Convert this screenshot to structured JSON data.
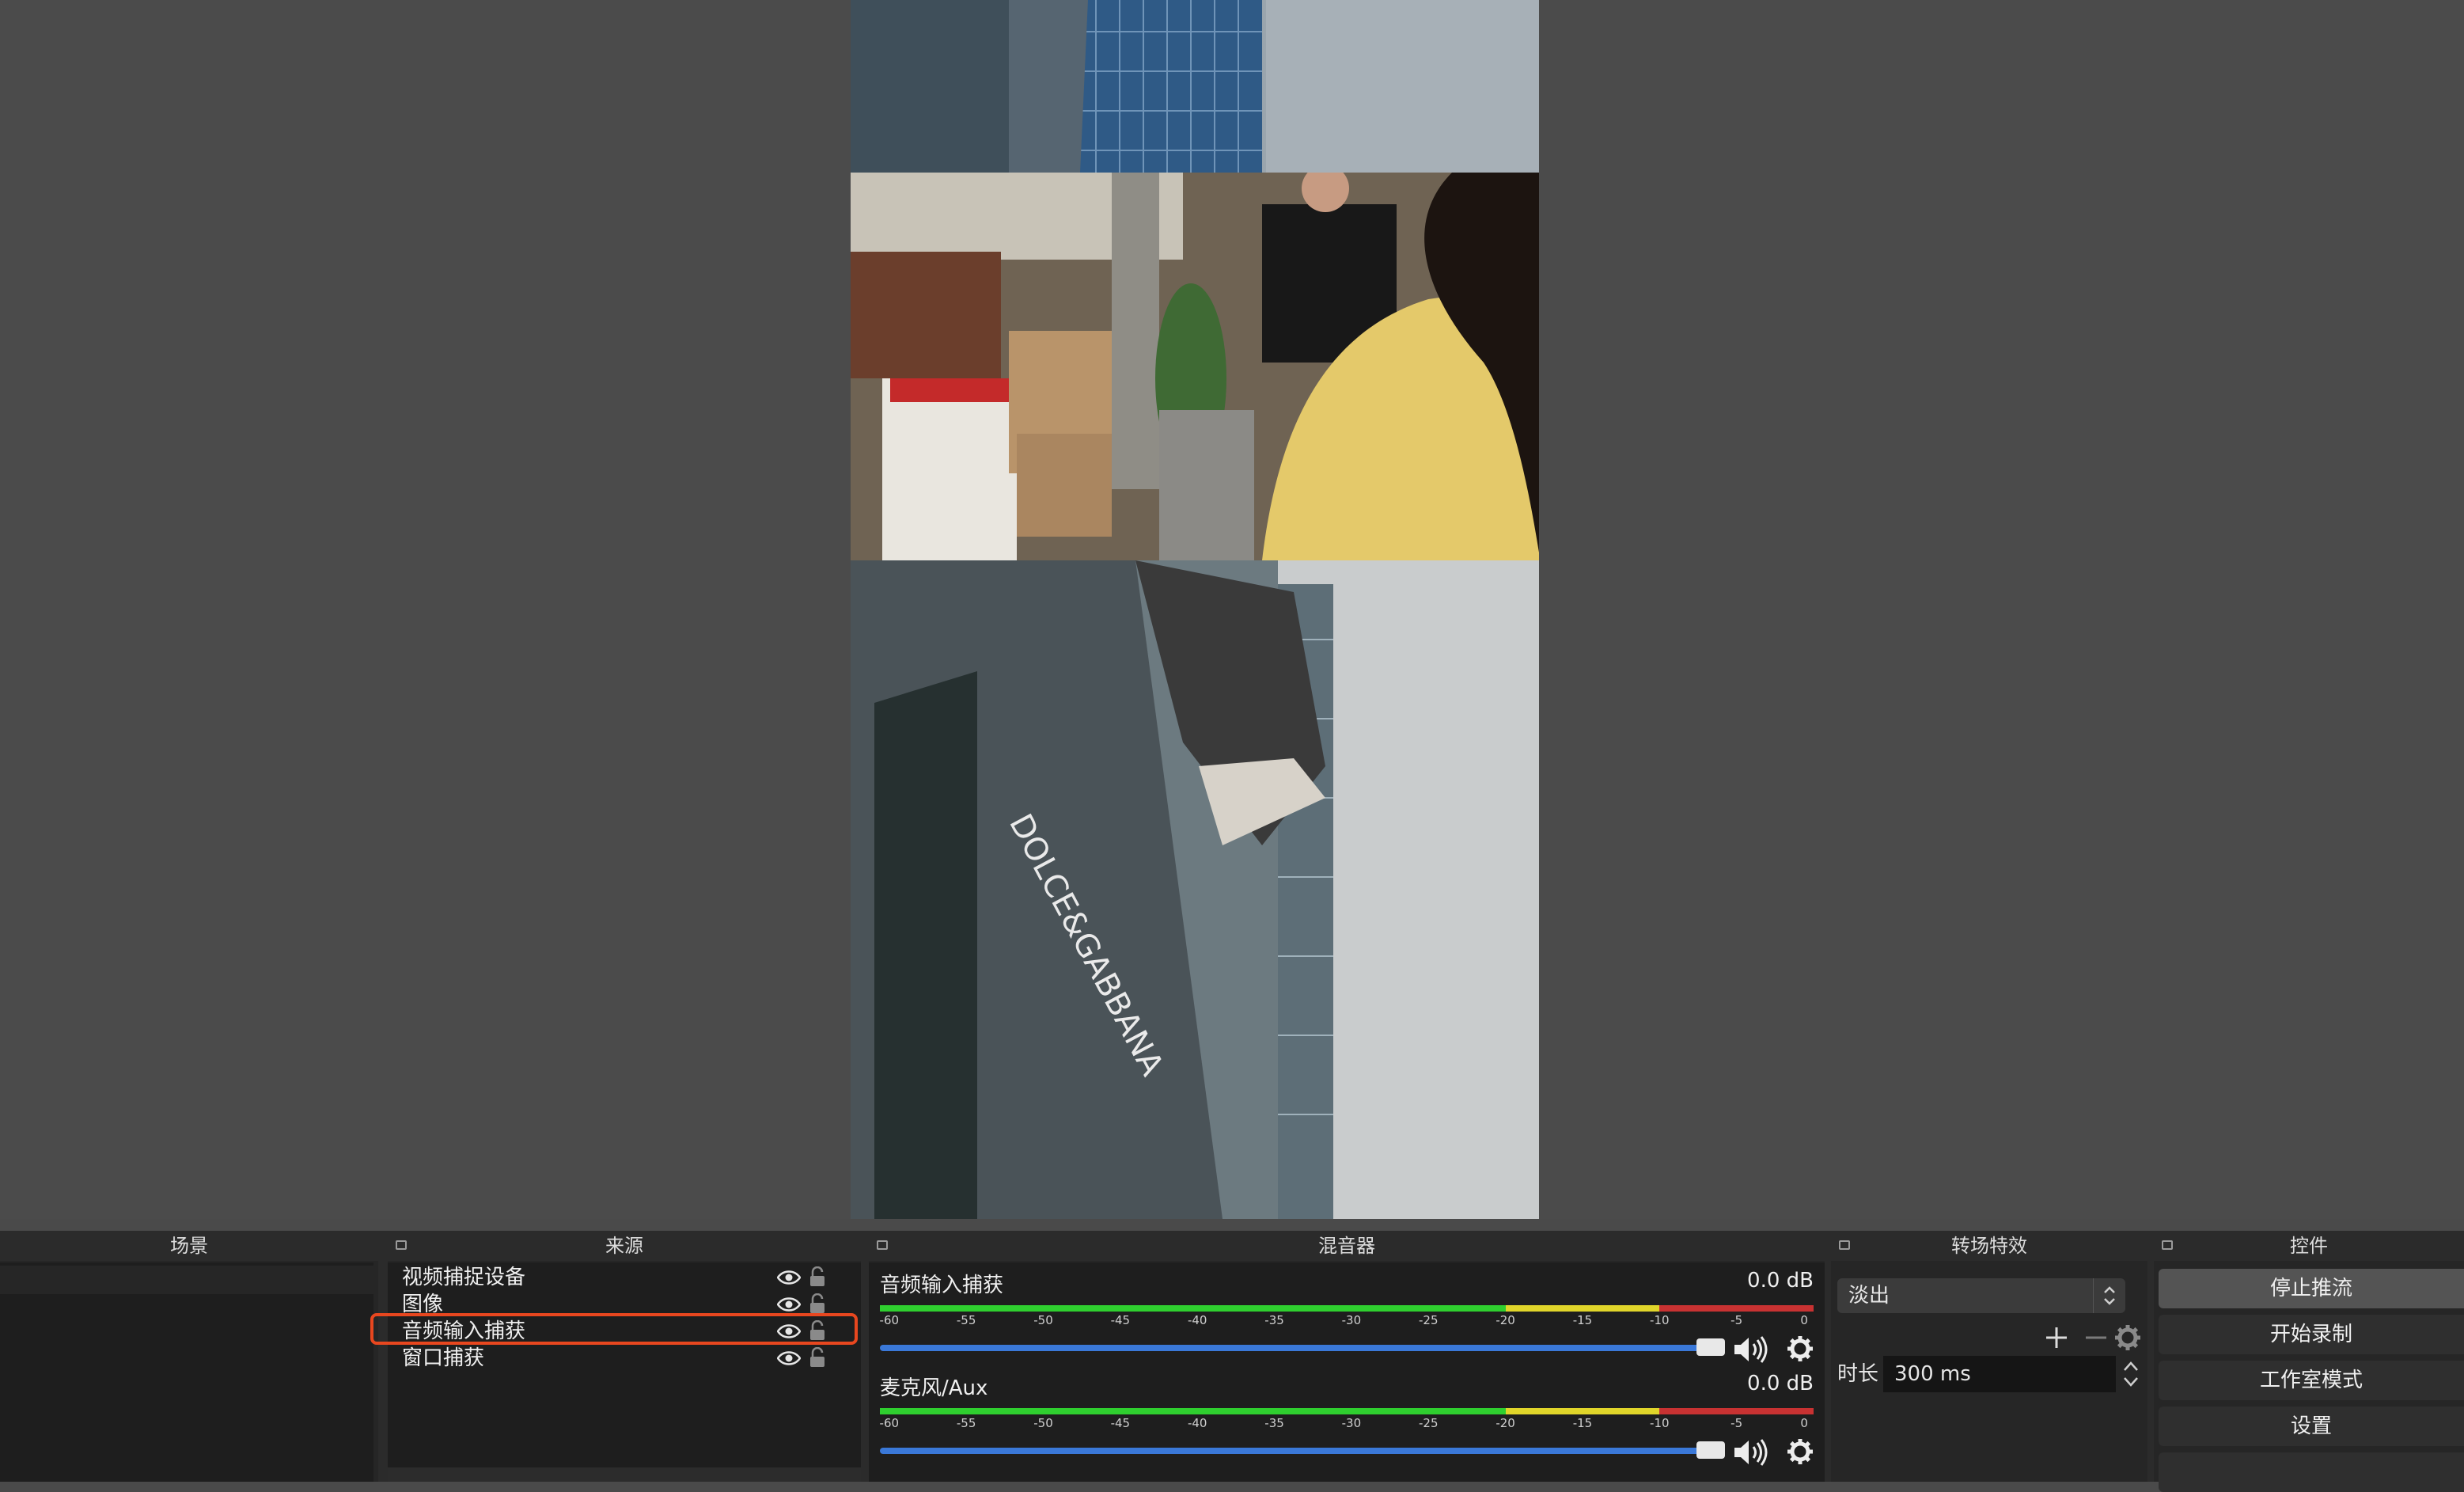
{
  "panels": {
    "scenes": {
      "title": "场景"
    },
    "sources": {
      "title": "来源",
      "items": [
        {
          "label": "视频捕捉设备"
        },
        {
          "label": "图像"
        },
        {
          "label": "音频输入捕获"
        },
        {
          "label": "窗口捕获"
        }
      ]
    },
    "mixer": {
      "title": "混音器",
      "ticks": [
        "-60",
        "-55",
        "-50",
        "-45",
        "-40",
        "-35",
        "-30",
        "-25",
        "-20",
        "-15",
        "-10",
        "-5",
        "0"
      ],
      "channels": [
        {
          "name": "音频输入捕获",
          "level": "0.0 dB"
        },
        {
          "name": "麦克风/Aux",
          "level": "0.0 dB"
        }
      ]
    },
    "transitions": {
      "title": "转场特效",
      "selected": "淡出",
      "duration_label": "时长",
      "duration_value": "300 ms"
    },
    "controls": {
      "title": "控件",
      "buttons": [
        {
          "label": "停止推流"
        },
        {
          "label": "开始录制"
        },
        {
          "label": "工作室模式"
        },
        {
          "label": "设置"
        }
      ]
    }
  },
  "colors": {
    "highlight": "#e8471f",
    "meter_green": "#2fcf2f",
    "meter_yellow": "#e0d52a",
    "meter_red": "#c83232",
    "fader_blue": "#3a78d8"
  },
  "icons": [
    "float-icon",
    "eye-icon",
    "lock-icon",
    "speaker-icon",
    "gear-icon",
    "plus-icon",
    "minus-icon"
  ]
}
